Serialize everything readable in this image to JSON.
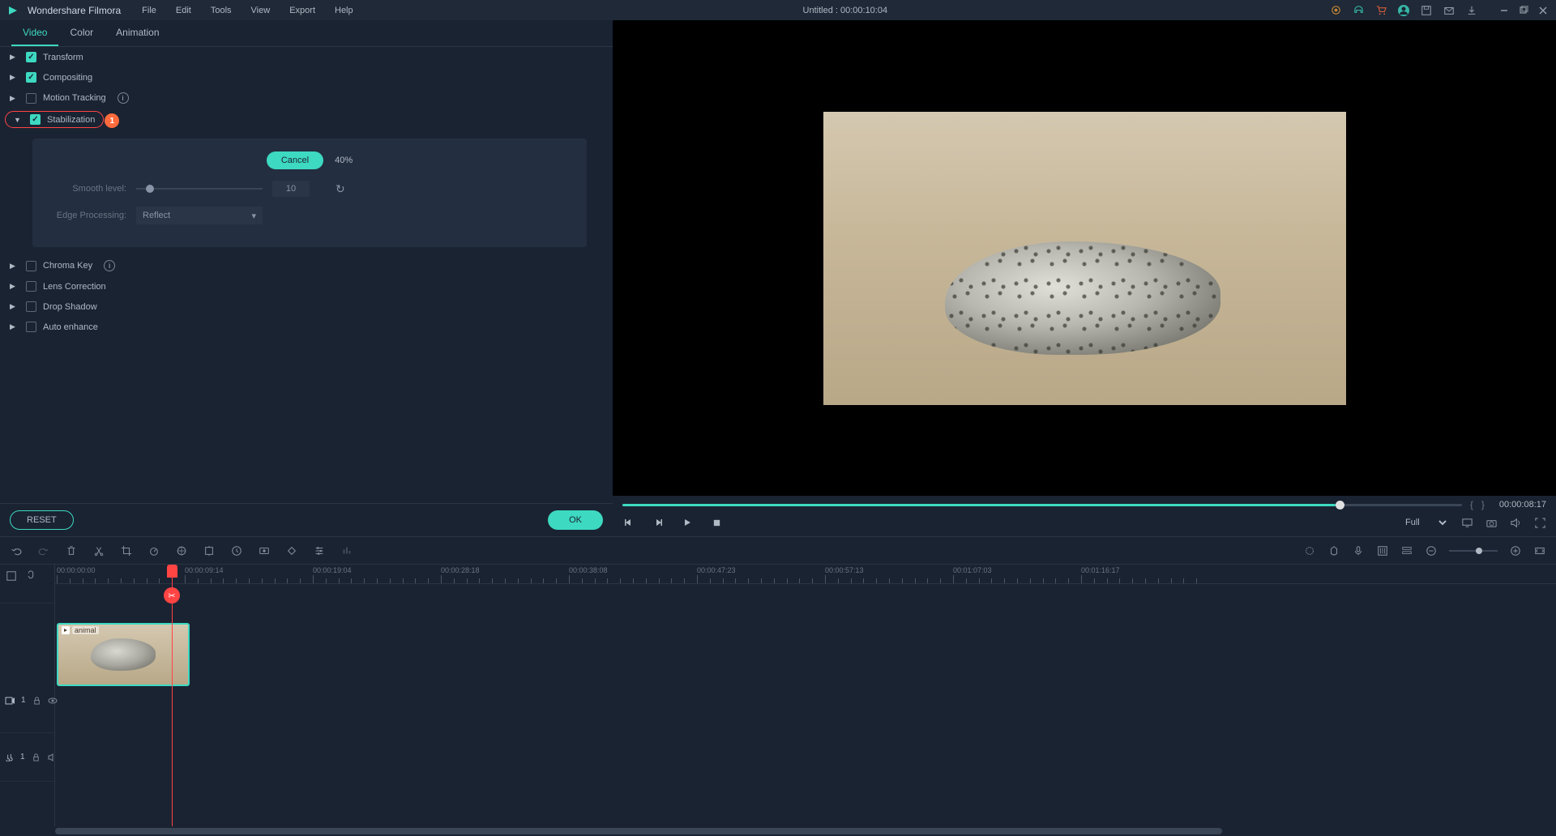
{
  "app": {
    "name": "Wondershare Filmora",
    "title": "Untitled : 00:00:10:04"
  },
  "menu": [
    "File",
    "Edit",
    "Tools",
    "View",
    "Export",
    "Help"
  ],
  "titlebar_icons": [
    "upgrade-icon",
    "headset-icon",
    "cart-icon",
    "account-icon",
    "save-icon",
    "mail-icon",
    "download-icon"
  ],
  "tabs": {
    "items": [
      "Video",
      "Color",
      "Animation"
    ],
    "active": 0
  },
  "properties": {
    "transform": {
      "label": "Transform",
      "checked": true,
      "expanded": false
    },
    "compositing": {
      "label": "Compositing",
      "checked": true,
      "expanded": false
    },
    "motion_tracking": {
      "label": "Motion Tracking",
      "checked": false,
      "expanded": false
    },
    "stabilization": {
      "label": "Stabilization",
      "checked": true,
      "expanded": true,
      "badge": "1",
      "cancel_label": "Cancel",
      "progress": "40%",
      "smooth_level": {
        "label": "Smooth level:",
        "value": "10"
      },
      "edge_processing": {
        "label": "Edge Processing:",
        "value": "Reflect"
      }
    },
    "chroma_key": {
      "label": "Chroma Key",
      "checked": false,
      "expanded": false
    },
    "lens_correction": {
      "label": "Lens Correction",
      "checked": false,
      "expanded": false
    },
    "drop_shadow": {
      "label": "Drop Shadow",
      "checked": false,
      "expanded": false
    },
    "auto_enhance": {
      "label": "Auto enhance",
      "checked": false,
      "expanded": false
    }
  },
  "footer": {
    "reset": "RESET",
    "ok": "OK"
  },
  "preview": {
    "timecode": "00:00:08:17",
    "zoom": "Full"
  },
  "timeline": {
    "timecodes": [
      "00:00:00:00",
      "00:00:09:14",
      "00:00:19:04",
      "00:00:28:18",
      "00:00:38:08",
      "00:00:47:23",
      "00:00:57:13",
      "00:01:07:03",
      "00:01:16:17"
    ],
    "video_track": {
      "label": "1"
    },
    "audio_track": {
      "label": "1"
    },
    "clip": {
      "name": "animal"
    }
  }
}
